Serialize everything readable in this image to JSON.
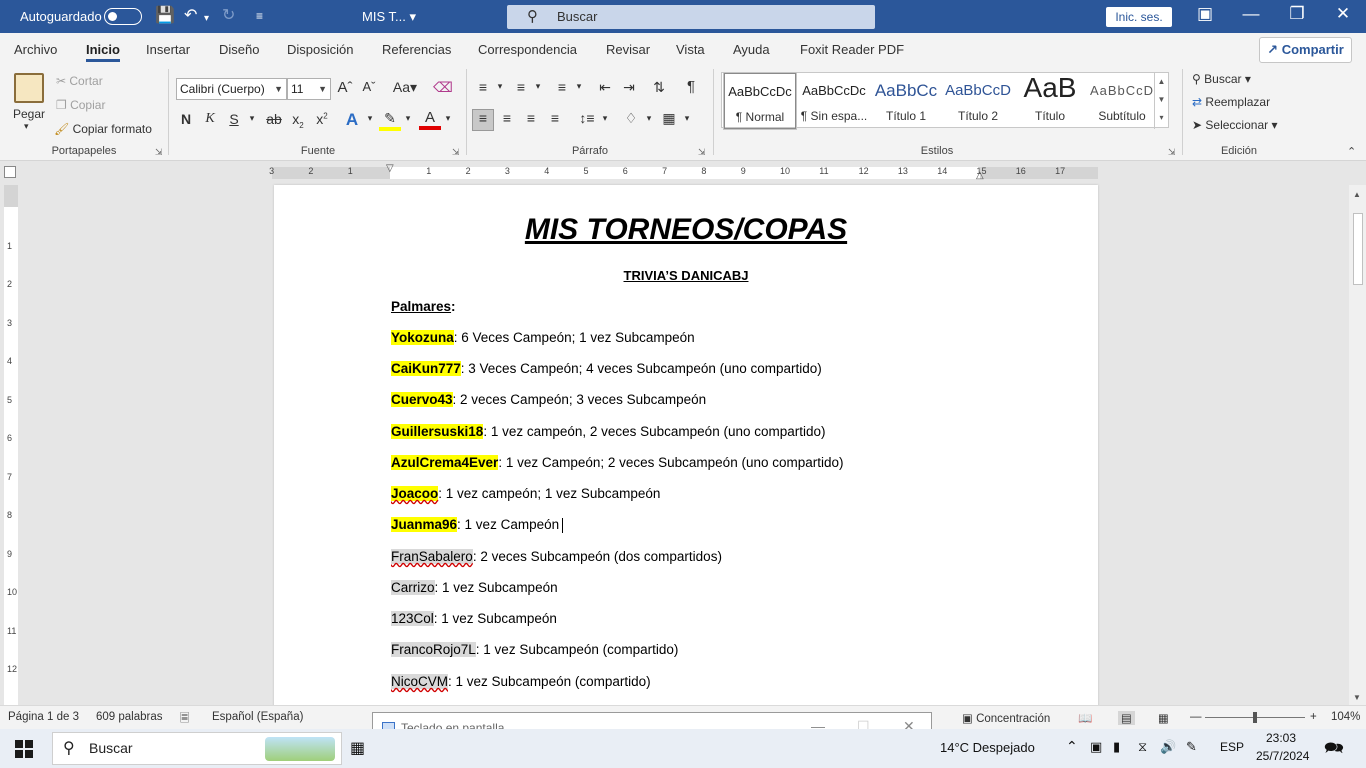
{
  "titlebar": {
    "autosave_label": "Autoguardado",
    "doc_name": "MIS T...",
    "search_placeholder": "Buscar",
    "signin_label": "Inic. ses."
  },
  "tabs": [
    "Archivo",
    "Inicio",
    "Insertar",
    "Diseño",
    "Disposición",
    "Referencias",
    "Correspondencia",
    "Revisar",
    "Vista",
    "Ayuda",
    "Foxit Reader PDF"
  ],
  "share_label": "Compartir",
  "ribbon": {
    "clipboard": {
      "paste": "Pegar",
      "cut": "Cortar",
      "copy": "Copiar",
      "format_painter": "Copiar formato",
      "label": "Portapapeles"
    },
    "font": {
      "family": "Calibri (Cuerpo)",
      "size": "11",
      "label": "Fuente"
    },
    "paragraph": {
      "label": "Párrafo"
    },
    "styles": {
      "label": "Estilos",
      "items": [
        {
          "preview": "AaBbCcDc",
          "name": "¶ Normal"
        },
        {
          "preview": "AaBbCcDc",
          "name": "¶ Sin espa..."
        },
        {
          "preview": "AaBbCc",
          "name": "Título 1"
        },
        {
          "preview": "AaBbCcD",
          "name": "Título 2"
        },
        {
          "preview": "AaB",
          "name": "Título"
        },
        {
          "preview": "AaBbCcD",
          "name": "Subtítulo"
        }
      ]
    },
    "editing": {
      "find": "Buscar",
      "replace": "Reemplazar",
      "select": "Seleccionar",
      "label": "Edición"
    }
  },
  "document": {
    "title": "MIS TORNEOS/COPAS",
    "subtitle": "TRIVIA’S DANICABJ",
    "section": "Palmares",
    "entries": [
      {
        "name": "Yokozuna",
        "text": ": 6 Veces Campeón; 1 vez Subcampeón"
      },
      {
        "name": "CaiKun777",
        "text": ": 3 Veces Campeón; 4 veces Subcampeón (uno compartido)"
      },
      {
        "name": "Cuervo43",
        "text": ": 2 veces Campeón; 3 veces Subcampeón"
      },
      {
        "name": "Guillersuski18",
        "text": ": 1 vez campeón, 2 veces Subcampeón (uno compartido)"
      },
      {
        "name": "AzulCrema4Ever",
        "text": ": 1 vez Campeón; 2 veces Subcampeón (uno compartido)"
      },
      {
        "name": "Joacoo",
        "text": ": 1 vez campeón; 1 vez Subcampeón"
      },
      {
        "name": "Juanma96",
        "text": ": 1 vez Campeón"
      },
      {
        "name": "FranSabalero",
        "text": ": 2 veces Subcampeón (dos compartidos)"
      },
      {
        "name": "Carrizo",
        "text": ": 1 vez Subcampeón"
      },
      {
        "name": "123Col",
        "text": ": 1 vez Subcampeón"
      },
      {
        "name": "FrancoRojo7L",
        "text": ": 1 vez Subcampeón (compartido)"
      },
      {
        "name": "NicoCVM",
        "text": ": 1 vez Subcampeón (compartido)"
      }
    ]
  },
  "status": {
    "page": "Página 1 de 3",
    "words": "609 palabras",
    "language": "Español (España)",
    "focus": "Concentración",
    "zoom": "104%"
  },
  "osk": {
    "title": "Teclado en pantalla"
  },
  "taskbar": {
    "search": "Buscar",
    "weather": "14°C  Despejado",
    "lang": "ESP",
    "time": "23:03",
    "date": "25/7/2024"
  }
}
